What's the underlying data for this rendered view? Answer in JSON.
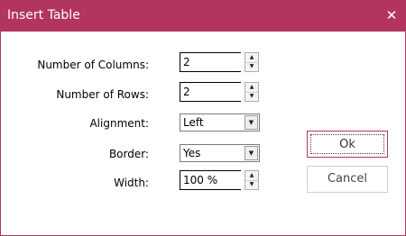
{
  "window": {
    "title": "Insert Table",
    "close_glyph": "✕"
  },
  "form": {
    "columns": {
      "label": "Number of Columns:",
      "value": "2"
    },
    "rows": {
      "label": "Number of Rows:",
      "value": "2"
    },
    "alignment": {
      "label": "Alignment:",
      "value": "Left"
    },
    "border": {
      "label": "Border:",
      "value": "Yes"
    },
    "width": {
      "label": "Width:",
      "value": "100 %"
    }
  },
  "buttons": {
    "ok_label": "Ok",
    "cancel_label": "Cancel"
  },
  "icons": {
    "spin_up": "▲",
    "spin_down": "▼",
    "dropdown": "▼"
  },
  "colors": {
    "accent": "#b2355e"
  }
}
